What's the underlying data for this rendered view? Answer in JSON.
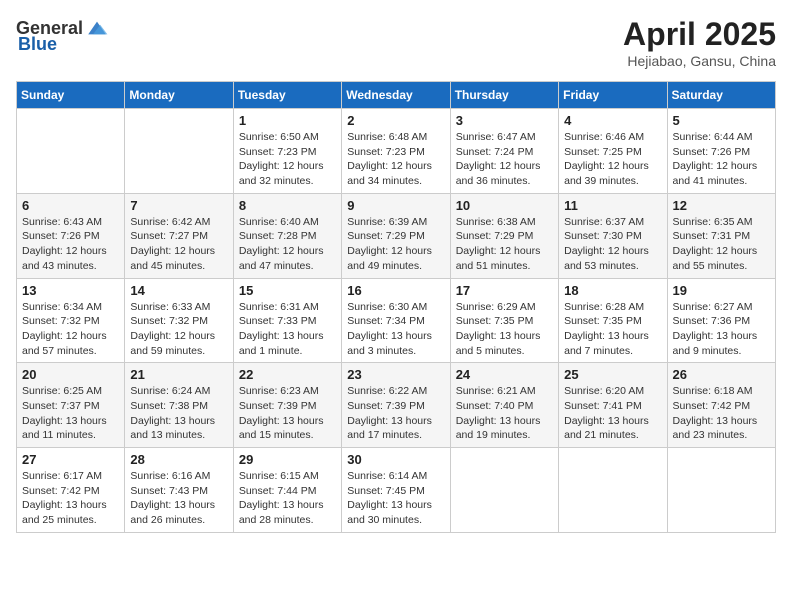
{
  "header": {
    "logo_general": "General",
    "logo_blue": "Blue",
    "month": "April 2025",
    "location": "Hejiabao, Gansu, China"
  },
  "columns": [
    "Sunday",
    "Monday",
    "Tuesday",
    "Wednesday",
    "Thursday",
    "Friday",
    "Saturday"
  ],
  "weeks": [
    [
      {
        "day": "",
        "info": ""
      },
      {
        "day": "",
        "info": ""
      },
      {
        "day": "1",
        "info": "Sunrise: 6:50 AM\nSunset: 7:23 PM\nDaylight: 12 hours\nand 32 minutes."
      },
      {
        "day": "2",
        "info": "Sunrise: 6:48 AM\nSunset: 7:23 PM\nDaylight: 12 hours\nand 34 minutes."
      },
      {
        "day": "3",
        "info": "Sunrise: 6:47 AM\nSunset: 7:24 PM\nDaylight: 12 hours\nand 36 minutes."
      },
      {
        "day": "4",
        "info": "Sunrise: 6:46 AM\nSunset: 7:25 PM\nDaylight: 12 hours\nand 39 minutes."
      },
      {
        "day": "5",
        "info": "Sunrise: 6:44 AM\nSunset: 7:26 PM\nDaylight: 12 hours\nand 41 minutes."
      }
    ],
    [
      {
        "day": "6",
        "info": "Sunrise: 6:43 AM\nSunset: 7:26 PM\nDaylight: 12 hours\nand 43 minutes."
      },
      {
        "day": "7",
        "info": "Sunrise: 6:42 AM\nSunset: 7:27 PM\nDaylight: 12 hours\nand 45 minutes."
      },
      {
        "day": "8",
        "info": "Sunrise: 6:40 AM\nSunset: 7:28 PM\nDaylight: 12 hours\nand 47 minutes."
      },
      {
        "day": "9",
        "info": "Sunrise: 6:39 AM\nSunset: 7:29 PM\nDaylight: 12 hours\nand 49 minutes."
      },
      {
        "day": "10",
        "info": "Sunrise: 6:38 AM\nSunset: 7:29 PM\nDaylight: 12 hours\nand 51 minutes."
      },
      {
        "day": "11",
        "info": "Sunrise: 6:37 AM\nSunset: 7:30 PM\nDaylight: 12 hours\nand 53 minutes."
      },
      {
        "day": "12",
        "info": "Sunrise: 6:35 AM\nSunset: 7:31 PM\nDaylight: 12 hours\nand 55 minutes."
      }
    ],
    [
      {
        "day": "13",
        "info": "Sunrise: 6:34 AM\nSunset: 7:32 PM\nDaylight: 12 hours\nand 57 minutes."
      },
      {
        "day": "14",
        "info": "Sunrise: 6:33 AM\nSunset: 7:32 PM\nDaylight: 12 hours\nand 59 minutes."
      },
      {
        "day": "15",
        "info": "Sunrise: 6:31 AM\nSunset: 7:33 PM\nDaylight: 13 hours\nand 1 minute."
      },
      {
        "day": "16",
        "info": "Sunrise: 6:30 AM\nSunset: 7:34 PM\nDaylight: 13 hours\nand 3 minutes."
      },
      {
        "day": "17",
        "info": "Sunrise: 6:29 AM\nSunset: 7:35 PM\nDaylight: 13 hours\nand 5 minutes."
      },
      {
        "day": "18",
        "info": "Sunrise: 6:28 AM\nSunset: 7:35 PM\nDaylight: 13 hours\nand 7 minutes."
      },
      {
        "day": "19",
        "info": "Sunrise: 6:27 AM\nSunset: 7:36 PM\nDaylight: 13 hours\nand 9 minutes."
      }
    ],
    [
      {
        "day": "20",
        "info": "Sunrise: 6:25 AM\nSunset: 7:37 PM\nDaylight: 13 hours\nand 11 minutes."
      },
      {
        "day": "21",
        "info": "Sunrise: 6:24 AM\nSunset: 7:38 PM\nDaylight: 13 hours\nand 13 minutes."
      },
      {
        "day": "22",
        "info": "Sunrise: 6:23 AM\nSunset: 7:39 PM\nDaylight: 13 hours\nand 15 minutes."
      },
      {
        "day": "23",
        "info": "Sunrise: 6:22 AM\nSunset: 7:39 PM\nDaylight: 13 hours\nand 17 minutes."
      },
      {
        "day": "24",
        "info": "Sunrise: 6:21 AM\nSunset: 7:40 PM\nDaylight: 13 hours\nand 19 minutes."
      },
      {
        "day": "25",
        "info": "Sunrise: 6:20 AM\nSunset: 7:41 PM\nDaylight: 13 hours\nand 21 minutes."
      },
      {
        "day": "26",
        "info": "Sunrise: 6:18 AM\nSunset: 7:42 PM\nDaylight: 13 hours\nand 23 minutes."
      }
    ],
    [
      {
        "day": "27",
        "info": "Sunrise: 6:17 AM\nSunset: 7:42 PM\nDaylight: 13 hours\nand 25 minutes."
      },
      {
        "day": "28",
        "info": "Sunrise: 6:16 AM\nSunset: 7:43 PM\nDaylight: 13 hours\nand 26 minutes."
      },
      {
        "day": "29",
        "info": "Sunrise: 6:15 AM\nSunset: 7:44 PM\nDaylight: 13 hours\nand 28 minutes."
      },
      {
        "day": "30",
        "info": "Sunrise: 6:14 AM\nSunset: 7:45 PM\nDaylight: 13 hours\nand 30 minutes."
      },
      {
        "day": "",
        "info": ""
      },
      {
        "day": "",
        "info": ""
      },
      {
        "day": "",
        "info": ""
      }
    ]
  ]
}
